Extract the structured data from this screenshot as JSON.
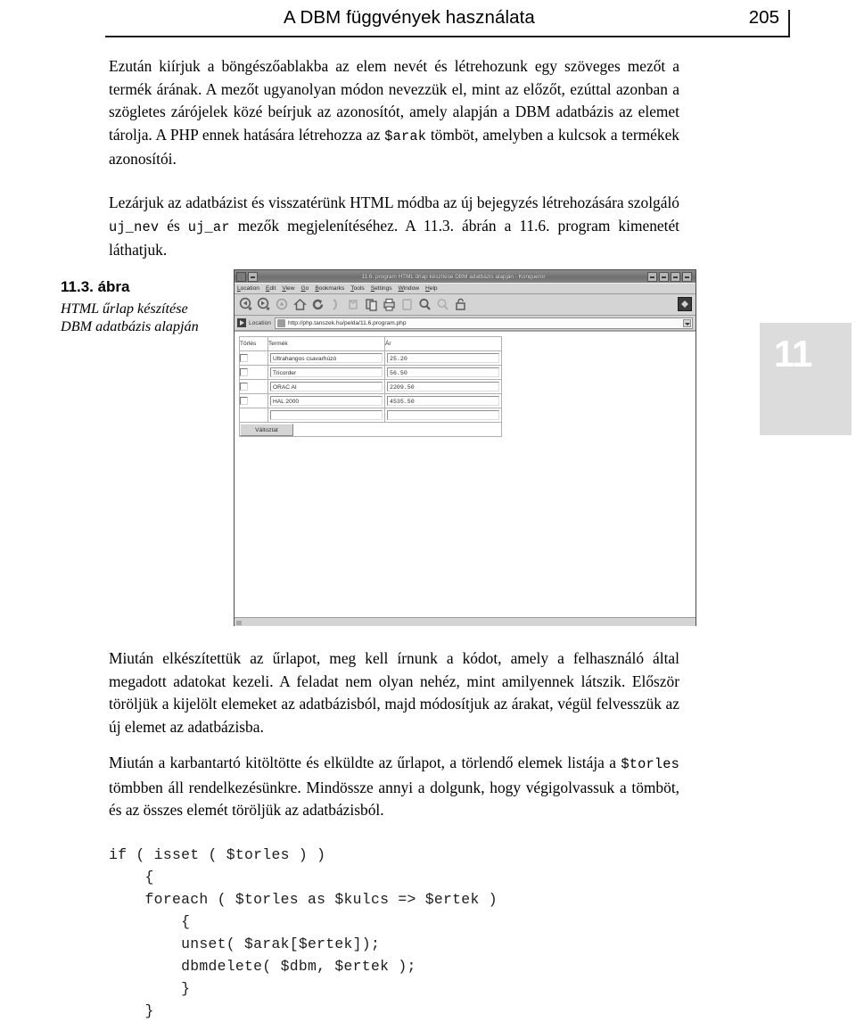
{
  "header": {
    "title": "A DBM függvények használata",
    "page_number": "205"
  },
  "chapter_tab": {
    "number": "11"
  },
  "figure": {
    "number": "11.3. ábra",
    "caption": "HTML űrlap készítése DBM adatbázis alapján"
  },
  "paragraphs": {
    "p1_a": "Ezután kiírjuk a böngészőablakba az elem nevét és létrehozunk egy szöveges mezőt a termék árának. A mezőt ugyanolyan módon nevezzük el, mint az előzőt, ezúttal azonban a szögletes zárójelek közé beírjuk az azonosítót, amely alapján a DBM adatbázis az elemet tárolja. A PHP ennek hatására létrehozza az ",
    "p1_code": "$arak",
    "p1_b": " tömböt, amelyben a kulcsok a termékek azonosítói.",
    "p2_a": "Lezárjuk az adatbázist és visszatérünk HTML módba az új bejegyzés létrehozására szolgáló ",
    "p2_code1": "uj_nev",
    "p2_b": " és ",
    "p2_code2": "uj_ar",
    "p2_c": " mezők megjelenítéséhez. A 11.3. ábrán a 11.6. program kimenetét láthatjuk.",
    "p3": "Miután elkészítettük az űrlapot, meg kell írnunk a kódot, amely a felhasználó által megadott adatokat kezeli. A feladat nem olyan nehéz, mint amilyennek látszik. Először töröljük a kijelölt elemeket az adatbázisból, majd módosítjuk az árakat, végül felvesszük az új elemet az adatbázisba.",
    "p4_a": "Miután a karbantartó kitöltötte és elküldte az űrlapot, a törlendő elemek listája a ",
    "p4_code": "$torles",
    "p4_b": " tömbben áll rendelkezésünkre. Mindössze annyi a dolgunk, hogy végigolvassuk a tömböt, és az összes elemét töröljük az adatbázisból."
  },
  "code_listing": "if ( isset ( $torles ) )\n    {\n    foreach ( $torles as $kulcs => $ertek )\n        {\n        unset( $arak[$ertek]);\n        dbmdelete( $dbm, $ertek );\n        }\n    }",
  "browser": {
    "window_title": "11.6. program HTML űrlap készítése DBM adatbázis alapján  -  Konqueror",
    "title_buttons": {
      "help": "?",
      "minimize": "–",
      "maximize": "□",
      "close": "✕"
    },
    "menus": [
      {
        "label": "Location",
        "mnemonic": "L"
      },
      {
        "label": "Edit",
        "mnemonic": "E"
      },
      {
        "label": "View",
        "mnemonic": "V"
      },
      {
        "label": "Go",
        "mnemonic": "G"
      },
      {
        "label": "Bookmarks",
        "mnemonic": "B"
      },
      {
        "label": "Tools",
        "mnemonic": "T"
      },
      {
        "label": "Settings",
        "mnemonic": "S"
      },
      {
        "label": "Window",
        "mnemonic": "W"
      },
      {
        "label": "Help",
        "mnemonic": "H"
      }
    ],
    "toolbar_icons": [
      "back-icon",
      "forward-icon",
      "up-icon",
      "home-icon",
      "reload-icon",
      "stop-icon",
      "cut-icon",
      "copy-icon",
      "print-icon",
      "find-icon",
      "zoom-in-icon",
      "zoom-out-icon",
      "lock-icon"
    ],
    "location": {
      "label": "Location",
      "url": "http://php.tanszek.hu/pelda/11.6.program.php"
    },
    "form": {
      "columns": [
        "Törlés",
        "Termék",
        "Ár"
      ],
      "rows": [
        {
          "delete_checked": false,
          "name": "Ultrahangos csavarhúzó",
          "price": "25.20"
        },
        {
          "delete_checked": false,
          "name": "Tricorder",
          "price": "56.50"
        },
        {
          "delete_checked": false,
          "name": "ORAC AI",
          "price": "2209.50"
        },
        {
          "delete_checked": false,
          "name": "HAL 2000",
          "price": "4535.50"
        }
      ],
      "new_row": {
        "name": "",
        "price": ""
      },
      "submit_label": "Változtat"
    }
  }
}
